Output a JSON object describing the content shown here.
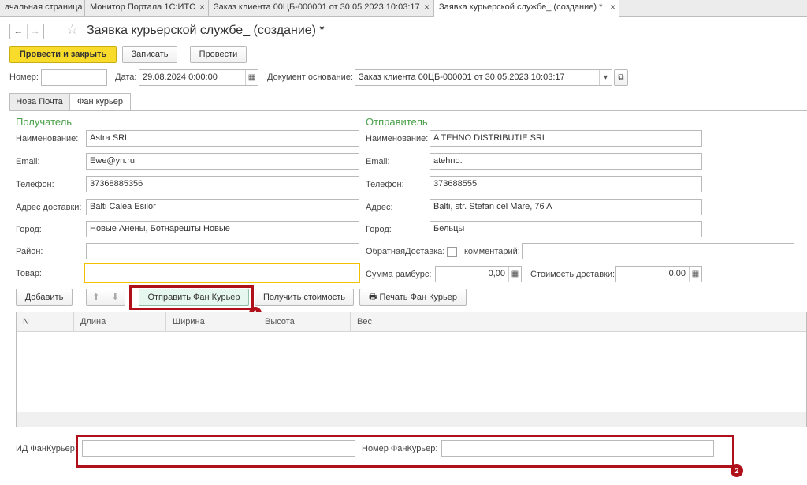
{
  "top_tabs": [
    {
      "label": "ачальная страница"
    },
    {
      "label": "Монитор Портала 1С:ИТС"
    },
    {
      "label": "Заказ клиента 00ЦБ-000001 от 30.05.2023 10:03:17"
    },
    {
      "label": "Заявка курьерской службе_ (создание) *"
    }
  ],
  "close_glyph": "×",
  "nav": {
    "back": "←",
    "forward": "→",
    "star": "☆"
  },
  "title": "Заявка курьерской службе_ (создание) *",
  "toolbar": {
    "post_close": "Провести и закрыть",
    "save": "Записать",
    "post": "Провести"
  },
  "header": {
    "number_label": "Номер:",
    "number_value": "",
    "date_label": "Дата:",
    "date_value": "29.08.2024  0:00:00",
    "basis_label": "Документ основание:",
    "basis_value": "Заказ клиента 00ЦБ-000001 от 30.05.2023 10:03:17"
  },
  "form_tabs": [
    {
      "label": "Нова Почта"
    },
    {
      "label": "Фан курьер"
    }
  ],
  "recipient": {
    "title": "Получатель",
    "name_label": "Наименование:",
    "name": "Astra SRL",
    "email_label": "Email:",
    "email": "Ewe@yn.ru",
    "phone_label": "Телефон:",
    "phone": "37368885356",
    "address_label": "Адрес доставки:",
    "address": "Balti Calea Esilor",
    "city_label": "Город:",
    "city": "Новые Анены, Ботнарешты Новые",
    "district_label": "Район:",
    "district": "",
    "goods_label": "Товар:",
    "goods": ""
  },
  "sender": {
    "title": "Отправитель",
    "name_label": "Наименование:",
    "name": "A TEHNO DISTRIBUTIE SRL",
    "email_label": "Email:",
    "email": "atehno.",
    "phone_label": "Телефон:",
    "phone": "373688555",
    "address_label": "Адрес:",
    "address": "Balti, str. Stefan cel Mare, 76 A",
    "city_label": "Город:",
    "city": "Бельцы",
    "return_label": "ОбратнаяДоставка:",
    "comment_label": "комментарий:",
    "comment": "",
    "cod_label": "Сумма рамбурс:",
    "cod": "0,00",
    "cost_label": "Стоимость доставки:",
    "cost": "0,00"
  },
  "actions": {
    "add": "Добавить",
    "up": "⬆",
    "down": "⬇",
    "send": "Отправить Фан Курьер",
    "get_cost": "Получить стоимость",
    "print": "Печать Фан Курьер"
  },
  "table": {
    "columns": [
      "N",
      "Длина",
      "Ширина",
      "Высота",
      "Вес"
    ],
    "rows": []
  },
  "footer": {
    "id_label": "ИД ФанКурьер:",
    "id_value": "",
    "number_label": "Номер ФанКурьер:",
    "number_value": ""
  },
  "badges": [
    "1",
    "2"
  ],
  "colors": {
    "primary_button": "#f9dc2b",
    "section_title": "#4aa04a",
    "highlight": "#b0101a"
  }
}
